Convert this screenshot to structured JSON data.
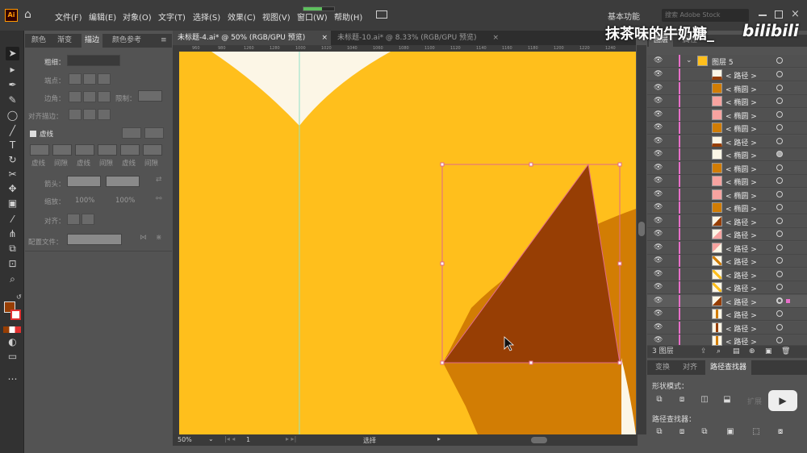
{
  "app": {
    "logo": "Ai",
    "home_icon": "home-icon"
  },
  "menu": [
    "文件(F)",
    "编辑(E)",
    "对象(O)",
    "文字(T)",
    "选择(S)",
    "效果(C)",
    "视图(V)",
    "窗口(W)",
    "帮助(H)"
  ],
  "workspace": "基本功能",
  "search": {
    "placeholder": "搜索 Adobe Stock"
  },
  "watermark": {
    "text": "抹茶味的牛奶糖_",
    "brand": "bilibili"
  },
  "documents": [
    {
      "title": "未标题-4.ai* @ 50% (RGB/GPU 预览)",
      "close": "×"
    },
    {
      "title": "未标题-10.ai* @ 8.33% (RGB/GPU 预览)",
      "close": "×"
    }
  ],
  "left_panel": {
    "tabs": [
      "颜色",
      "渐变",
      "描边",
      "颜色参考"
    ],
    "weight_label": "粗细：",
    "miter_label": "端点：",
    "corner_label": "边角：",
    "limit_label": "限制：",
    "align_label": "对齐描边：",
    "dash_label": "虚线",
    "dash_headers": [
      "虚线",
      "间隙",
      "虚线",
      "间隙",
      "虚线",
      "间隙"
    ],
    "arrow_label": "箭头：",
    "scale_label": "缩放：",
    "scale_values": [
      "100%",
      "100%"
    ],
    "align2_label": "对齐：",
    "profile_label": "配置文件："
  },
  "ruler_labels": [
    "960",
    "980",
    "1000",
    "1020",
    "1040",
    "1060",
    "1080",
    "1100",
    "1120",
    "1140",
    "1160",
    "1180",
    "1200",
    "1220",
    "1240",
    "1260",
    "1280"
  ],
  "status": {
    "zoom": "50%",
    "artboard": "1",
    "tool": "选择"
  },
  "layers_panel": {
    "tabs": [
      "图层",
      "属性"
    ],
    "top_layer": "图层 5",
    "rows": [
      "< 路径 >",
      "< 椭圆 >",
      "< 椭圆 >",
      "< 椭圆 >",
      "< 椭圆 >",
      "< 路径 >",
      "< 椭圆 >",
      "< 椭圆 >",
      "< 椭圆 >",
      "< 椭圆 >",
      "< 椭圆 >",
      "< 路径 >",
      "< 路径 >",
      "< 路径 >",
      "< 路径 >",
      "< 路径 >",
      "< 路径 >",
      "< 路径 >",
      "< 路径 >",
      "< 路径 >",
      "< 路径 >"
    ],
    "footer": "3 图层"
  },
  "pathfinder": {
    "tabs": [
      "变换",
      "对齐",
      "路径查找器"
    ],
    "shape_modes_label": "形状模式：",
    "pathfinders_label": "路径查找器：",
    "expand_label": "扩展"
  },
  "colors": {
    "canvas": "#ffbf1c",
    "cream": "#fcf6e6",
    "dark": "#973e04",
    "mid": "#d27d04",
    "selection": "#e06a8a"
  }
}
